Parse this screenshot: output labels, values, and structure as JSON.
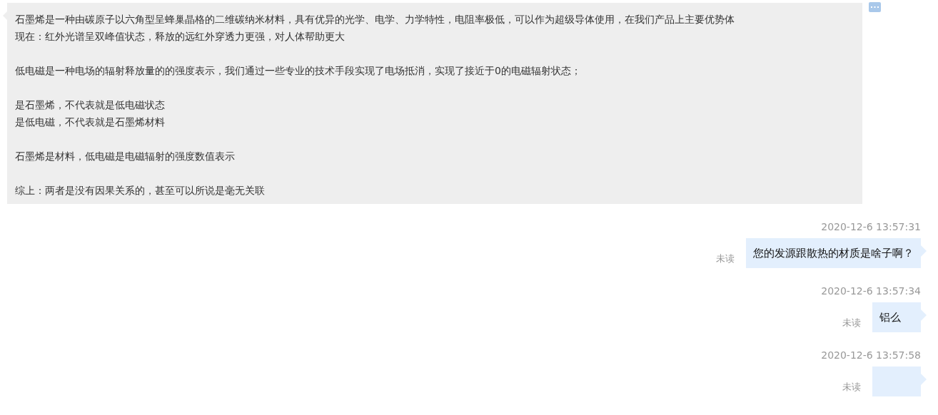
{
  "incoming": {
    "paragraphs": [
      [
        "石墨烯是一种由碳原子以六角型呈蜂巢晶格的二维碳纳米材料，具有优异的光学、电学、力学特性，电阻率极低，可以作为超级导体使用，在我们产品上主要优势体",
        "现在：红外光谱呈双峰值状态，释放的远红外穿透力更强，对人体帮助更大"
      ],
      [
        "低电磁是一种电场的辐射释放量的的强度表示，我们通过一些专业的技术手段实现了电场抵消，实现了接近于0的电磁辐射状态；"
      ],
      [
        "是石墨烯，不代表就是低电磁状态",
        "是低电磁，不代表就是石墨烯材料"
      ],
      [
        "石墨烯是材料，低电磁是电磁辐射的强度数值表示"
      ],
      [
        "综上：两者是没有因果关系的，甚至可以所说是毫无关联"
      ]
    ]
  },
  "outgoing": [
    {
      "time": "2020-12-6 13:57:31",
      "status": "未读",
      "text": "您的发源跟散热的材质是啥子啊？"
    },
    {
      "time": "2020-12-6 13:57:34",
      "status": "未读",
      "text": "铝么"
    },
    {
      "time": "2020-12-6 13:57:58",
      "status": "未读"
    }
  ]
}
